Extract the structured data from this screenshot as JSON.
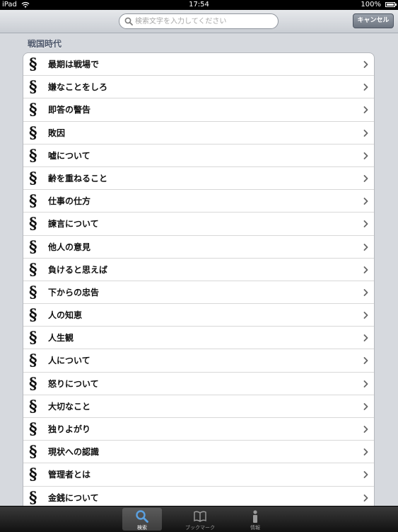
{
  "status_bar": {
    "carrier": "iPad",
    "time": "17:54",
    "battery": "100%"
  },
  "search": {
    "placeholder": "検索文字を入力してください",
    "cancel_label": "キャンセル"
  },
  "section": {
    "title": "戦国時代",
    "marker": "§",
    "items": [
      {
        "label": "最期は戦場で"
      },
      {
        "label": "嫌なことをしろ"
      },
      {
        "label": "即答の警告"
      },
      {
        "label": "敗因"
      },
      {
        "label": "嘘について"
      },
      {
        "label": "齢を重ねること"
      },
      {
        "label": "仕事の仕方"
      },
      {
        "label": "諫言について"
      },
      {
        "label": "他人の意見"
      },
      {
        "label": "負けると思えば"
      },
      {
        "label": "下からの忠告"
      },
      {
        "label": "人の知恵"
      },
      {
        "label": "人生観"
      },
      {
        "label": "人について"
      },
      {
        "label": "怒りについて"
      },
      {
        "label": "大切なこと"
      },
      {
        "label": "独りよがり"
      },
      {
        "label": "現状への認識"
      },
      {
        "label": "管理者とは"
      },
      {
        "label": "金銭について"
      }
    ]
  },
  "tabbar": {
    "tabs": [
      {
        "label": "検索",
        "icon": "search-icon",
        "selected": true
      },
      {
        "label": "ブックマーク",
        "icon": "book-icon",
        "selected": false
      },
      {
        "label": "情報",
        "icon": "info-icon",
        "selected": false
      }
    ]
  },
  "colors": {
    "status_bar": "#000000",
    "tabbar": "#1a1a1a",
    "section_header": "#4c566a"
  }
}
